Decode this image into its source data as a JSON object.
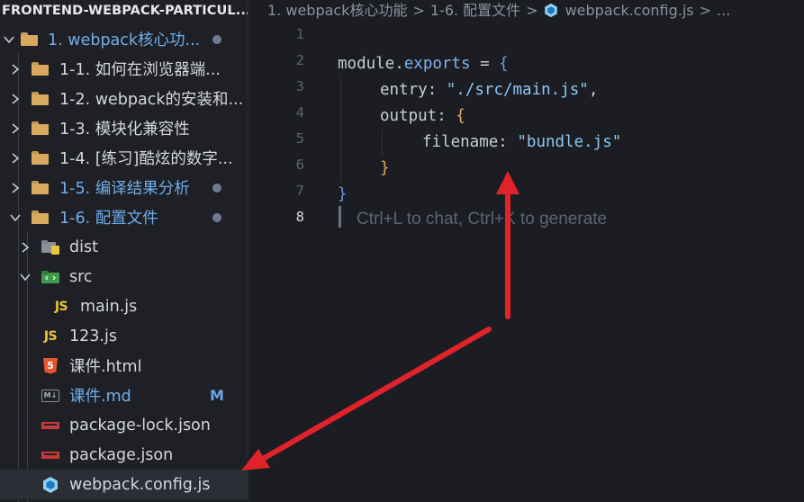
{
  "explorer": {
    "root_title": "FRONTEND-WEBPACK-PARTICUL...",
    "items": [
      {
        "label": "1. webpack核心功...",
        "type": "folder",
        "expanded": true,
        "badge": "dot"
      },
      {
        "label": "1-1. 如何在浏览器端...",
        "type": "folder",
        "expanded": false
      },
      {
        "label": "1-2. webpack的安装和...",
        "type": "folder",
        "expanded": false
      },
      {
        "label": "1-3. 模块化兼容性",
        "type": "folder",
        "expanded": false
      },
      {
        "label": "1-4. [练习]酷炫的数字...",
        "type": "folder",
        "expanded": false
      },
      {
        "label": "1-5. 编译结果分析",
        "type": "folder",
        "expanded": false,
        "badge": "dot"
      },
      {
        "label": "1-6. 配置文件",
        "type": "folder",
        "expanded": true,
        "badge": "dot"
      },
      {
        "label": "dist",
        "type": "folder-dist",
        "expanded": false
      },
      {
        "label": "src",
        "type": "folder-src",
        "expanded": true
      },
      {
        "label": "main.js",
        "type": "js"
      },
      {
        "label": "123.js",
        "type": "js"
      },
      {
        "label": "课件.html",
        "type": "html"
      },
      {
        "label": "课件.md",
        "type": "md",
        "badge": "M"
      },
      {
        "label": "package-lock.json",
        "type": "npm"
      },
      {
        "label": "package.json",
        "type": "npm"
      },
      {
        "label": "webpack.config.js",
        "type": "webpack",
        "selected": true
      }
    ],
    "js_icon_text": "JS",
    "html_icon_text": "5",
    "md_icon_text": "M↓"
  },
  "breadcrumb": {
    "parts": [
      "1. webpack核心功能",
      "1-6. 配置文件",
      "webpack.config.js",
      "..."
    ],
    "separator": ">"
  },
  "editor": {
    "line_numbers": [
      "1",
      "2",
      "3",
      "4",
      "5",
      "6",
      "7",
      "8"
    ],
    "current_line": "8",
    "code": {
      "l2_obj": "module",
      "l2_dot": ".",
      "l2_prop": "exports",
      "l2_eq": " = ",
      "l2_brace": "{",
      "l3_key": "entry",
      "l3_colon": ": ",
      "l3_val": "\"./src/main.js\"",
      "l3_comma": ",",
      "l4_key": "output",
      "l4_colon": ": ",
      "l4_brace": "{",
      "l5_key": "filename",
      "l5_colon": ": ",
      "l5_val": "\"bundle.js\"",
      "l6_brace": "}",
      "l7_brace": "}"
    },
    "ghost_hint": "Ctrl+L to chat, Ctrl+K to generate"
  },
  "colors": {
    "arrow": "#e0232a",
    "accent": "#6eaeea"
  }
}
